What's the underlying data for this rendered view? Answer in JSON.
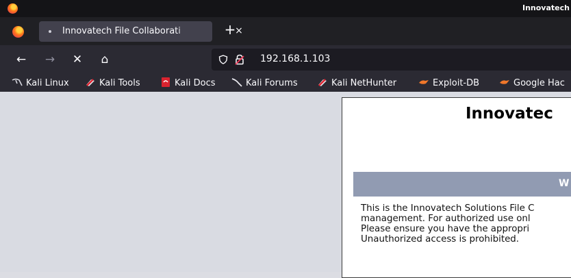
{
  "window": {
    "title": "Innovatech"
  },
  "tabs": [
    {
      "label": "Innovatech File Collaborati",
      "close": "×"
    }
  ],
  "newtab": {
    "label": "+"
  },
  "nav": {
    "back": "←",
    "forward": "→",
    "stop": "✕",
    "home": "⌂"
  },
  "urlbar": {
    "url": "192.168.1.103"
  },
  "bookmarks": [
    {
      "label": "Kali Linux",
      "icon": "kali-dragon-icon"
    },
    {
      "label": "Kali Tools",
      "icon": "kali-tools-icon"
    },
    {
      "label": "Kali Docs",
      "icon": "kali-docs-icon"
    },
    {
      "label": "Kali Forums",
      "icon": "kali-forums-icon"
    },
    {
      "label": "Kali NetHunter",
      "icon": "nethunter-icon"
    },
    {
      "label": "Exploit-DB",
      "icon": "exploit-db-icon"
    },
    {
      "label": "Google Hac",
      "icon": "ghdb-icon"
    }
  ],
  "page": {
    "heading": "Innovatec",
    "band_text": "W",
    "paragraph": [
      "This is the Innovatech Solutions File C",
      "management. For authorized use onl",
      "Please ensure you have the appropri",
      "Unauthorized access is prohibited."
    ]
  },
  "colors": {
    "titlebar": "#141417",
    "tabbar": "#202024",
    "toolbar": "#2b2a33",
    "band": "#919bb2",
    "viewport": "#d9dbe2"
  }
}
